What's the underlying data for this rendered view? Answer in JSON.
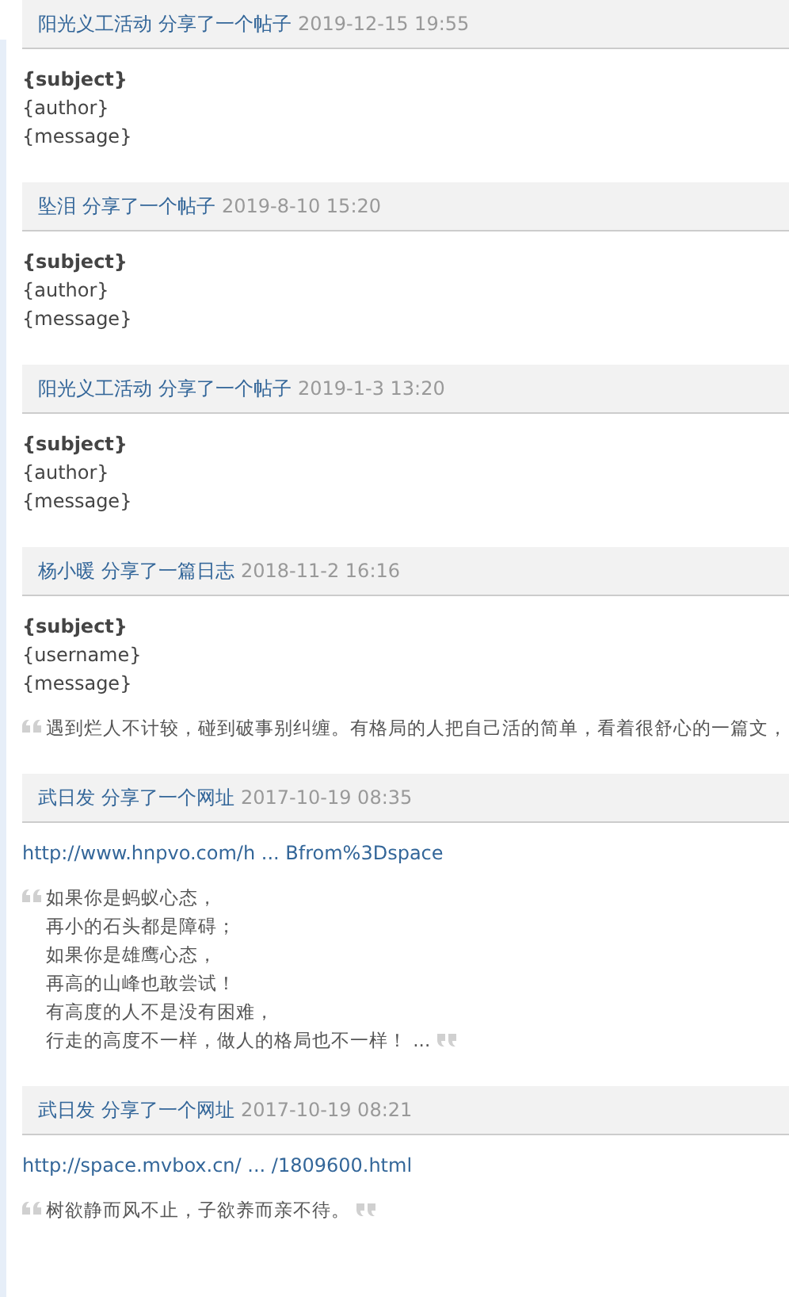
{
  "feed": [
    {
      "user": "阳光义工活动",
      "action": "分享了一个帖子",
      "time": "2019-12-15 19:55",
      "lines": [
        {
          "kind": "subject",
          "text": "{subject}"
        },
        {
          "kind": "plain",
          "text": "{author}"
        },
        {
          "kind": "plain",
          "text": "{message}"
        }
      ]
    },
    {
      "user": "坠泪",
      "action": "分享了一个帖子",
      "time": "2019-8-10 15:20",
      "lines": [
        {
          "kind": "subject",
          "text": "{subject}"
        },
        {
          "kind": "plain",
          "text": "{author}"
        },
        {
          "kind": "plain",
          "text": "{message}"
        }
      ]
    },
    {
      "user": "阳光义工活动",
      "action": "分享了一个帖子",
      "time": "2019-1-3 13:20",
      "lines": [
        {
          "kind": "subject",
          "text": "{subject}"
        },
        {
          "kind": "plain",
          "text": "{author}"
        },
        {
          "kind": "plain",
          "text": "{message}"
        }
      ]
    },
    {
      "user": "杨小暖",
      "action": "分享了一篇日志",
      "time": "2018-11-2 16:16",
      "lines": [
        {
          "kind": "subject",
          "text": "{subject}"
        },
        {
          "kind": "plain",
          "text": "{username}"
        },
        {
          "kind": "plain",
          "text": "{message}"
        }
      ],
      "quote": {
        "lines": [
          "遇到烂人不计较，碰到破事别纠缠。有格局的人把自己活的简单，看着很舒心的一篇文，"
        ],
        "closing_mark": false
      }
    },
    {
      "user": "武日发",
      "action": "分享了一个网址",
      "time": "2017-10-19 08:35",
      "lines": [
        {
          "kind": "link",
          "text": "http://www.hnpvo.com/h ... Bfrom%3Dspace"
        }
      ],
      "quote": {
        "lines": [
          "如果你是蚂蚁心态，",
          "再小的石头都是障碍；",
          "如果你是雄鹰心态，",
          "再高的山峰也敢尝试！",
          "有高度的人不是没有困难，",
          "行走的高度不一样，做人的格局也不一样！ ..."
        ],
        "closing_mark": true
      }
    },
    {
      "user": "武日发",
      "action": "分享了一个网址",
      "time": "2017-10-19 08:21",
      "lines": [
        {
          "kind": "link",
          "text": "http://space.mvbox.cn/ ... /1809600.html"
        }
      ],
      "quote": {
        "lines": [
          "树欲静而风不止，子欲养而亲不待。"
        ],
        "closing_mark": true
      }
    }
  ]
}
